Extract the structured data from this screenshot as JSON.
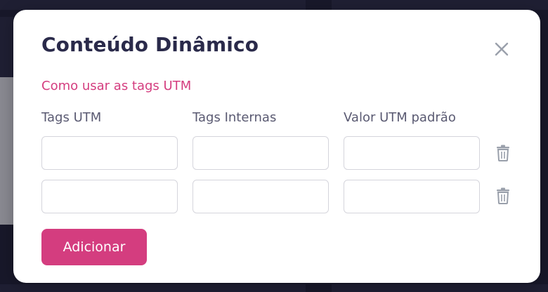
{
  "modal": {
    "title": "Conteúdo Dinâmico",
    "link_label": "Como usar as tags UTM",
    "columns": [
      "Tags UTM",
      "Tags Internas",
      "Valor UTM padrão"
    ],
    "rows": [
      {
        "utm_tag": "",
        "internal_tag": "",
        "default_value": ""
      },
      {
        "utm_tag": "",
        "internal_tag": "",
        "default_value": ""
      }
    ],
    "add_label": "Adicionar",
    "close_icon": "close-icon",
    "delete_icon": "trash-icon",
    "colors": {
      "accent": "#d43d7f",
      "title": "#2a2a4a",
      "label": "#5a5a72",
      "icon": "#9aa0ab"
    }
  }
}
